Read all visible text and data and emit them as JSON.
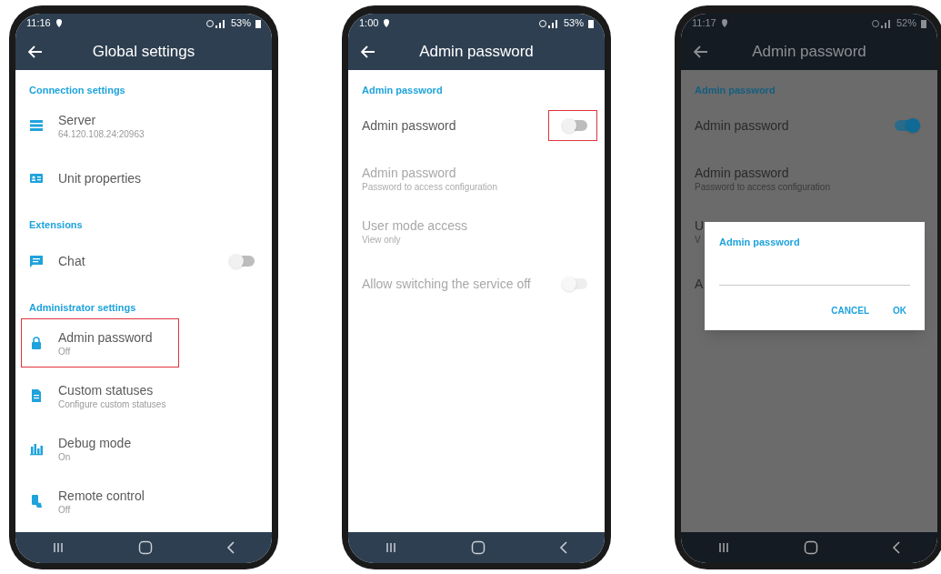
{
  "phones": [
    {
      "status_bar": {
        "time": "11:16",
        "battery": "53%"
      },
      "title": "Global settings",
      "dimmed": false,
      "sections": [
        {
          "header": "Connection settings",
          "items": [
            {
              "kind": "text",
              "label": "Server",
              "sublabel": "64.120.108.24:20963",
              "disabled": false,
              "highlighted": false
            },
            {
              "kind": "text",
              "label": "Unit properties",
              "disabled": false,
              "highlighted": false
            }
          ]
        },
        {
          "header": "Extensions",
          "items": [
            {
              "kind": "toggle",
              "label": "Chat",
              "on": false,
              "disabled": false,
              "highlighted": false
            }
          ]
        },
        {
          "header": "Administrator settings",
          "items": [
            {
              "kind": "text",
              "label": "Admin password",
              "sublabel": "Off",
              "disabled": false,
              "highlighted": true
            },
            {
              "kind": "text",
              "label": "Custom statuses",
              "sublabel": "Configure custom statuses",
              "disabled": false,
              "highlighted": false
            },
            {
              "kind": "text",
              "label": "Debug mode",
              "sublabel": "On",
              "disabled": false,
              "highlighted": false
            },
            {
              "kind": "text",
              "label": "Remote control",
              "sublabel": "Off",
              "disabled": false,
              "highlighted": false
            }
          ]
        }
      ]
    },
    {
      "status_bar": {
        "time": "1:00",
        "battery": "53%"
      },
      "title": "Admin password",
      "dimmed": false,
      "sections": [
        {
          "header": "Admin password",
          "items": [
            {
              "kind": "toggle",
              "label": "Admin password",
              "on": false,
              "disabled": false,
              "highlighted": true
            },
            {
              "kind": "text",
              "label": "Admin password",
              "sublabel": "Password to access configuration",
              "disabled": true,
              "highlighted": false
            },
            {
              "kind": "text",
              "label": "User mode access",
              "sublabel": "View only",
              "disabled": true,
              "highlighted": false
            },
            {
              "kind": "toggle",
              "label": "Allow switching the service off",
              "on": false,
              "disabled": true,
              "highlighted": false
            }
          ]
        }
      ]
    },
    {
      "status_bar": {
        "time": "11:17",
        "battery": "52%"
      },
      "title": "Admin password",
      "dimmed": true,
      "sections": [
        {
          "header": "Admin password",
          "items": [
            {
              "kind": "toggle",
              "label": "Admin password",
              "on": true,
              "disabled": false,
              "highlighted": false
            },
            {
              "kind": "text",
              "label": "Admin password",
              "sublabel": "Password to access configuration",
              "disabled": false,
              "highlighted": false
            },
            {
              "kind": "text",
              "label": "U",
              "sublabel": "V",
              "disabled": false,
              "highlighted": false
            },
            {
              "kind": "text",
              "label": "A",
              "disabled": false,
              "highlighted": false
            }
          ]
        }
      ],
      "dialog": {
        "title": "Admin password",
        "buttons": [
          "CANCEL",
          "OK"
        ]
      }
    }
  ]
}
